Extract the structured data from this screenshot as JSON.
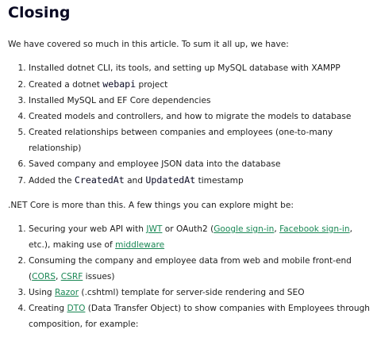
{
  "heading": "Closing",
  "intro": "We have covered so much in this article. To sum it all up, we have:",
  "summary_list": {
    "item1": "Installed dotnet CLI, its tools, and setting up MySQL database with XAMPP",
    "item2_pre": "Created a dotnet ",
    "item2_code": "webapi",
    "item2_post": " project",
    "item3": "Installed MySQL and EF Core dependencies",
    "item4": "Created models and controllers, and how to migrate the models to database",
    "item5": "Created relationships between companies and employees (one-to-many relationship)",
    "item6": "Saved company and employee JSON data into the database",
    "item7_pre": "Added the ",
    "item7_code1": "CreatedAt",
    "item7_mid": " and ",
    "item7_code2": "UpdatedAt",
    "item7_post": " timestamp"
  },
  "outro": ".NET Core is more than this. A few things you can explore might be:",
  "explore_list": {
    "item1_pre": "Securing your web API with ",
    "item1_link_jwt": "JWT",
    "item1_mid1": " or OAuth2 (",
    "item1_link_google": "Google sign-in",
    "item1_mid2": ", ",
    "item1_link_facebook": "Facebook sign-in",
    "item1_mid3": ", etc.), making use of ",
    "item1_link_middleware": "middleware",
    "item2_pre": "Consuming the company and employee data from web and mobile front-end (",
    "item2_link_cors": "CORS",
    "item2_mid": ", ",
    "item2_link_csrf": "CSRF",
    "item2_post": " issues)",
    "item3_pre": "Using ",
    "item3_link_razor": "Razor",
    "item3_post": " (.cshtml) template for server-side rendering and SEO",
    "item4_pre": "Creating ",
    "item4_link_dto": "DTO",
    "item4_post": " (Data Transfer Object) to show companies with Employees through composition, for example:"
  },
  "colors": {
    "link": "#198754",
    "text": "#1b1b1b",
    "heading": "#0a0a23"
  }
}
